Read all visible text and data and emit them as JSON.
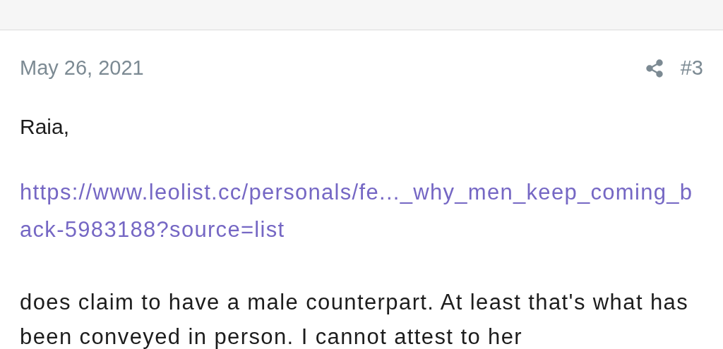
{
  "post": {
    "date": "May 26, 2021",
    "number": "#3",
    "greeting": "Raia,",
    "link": "https://www.leolist.cc/personals/fe..._why_men_keep_coming_back-5983188?source=list",
    "body": "does claim to have a male counterpart. At least that's what has been conveyed in person. I cannot attest to her"
  }
}
